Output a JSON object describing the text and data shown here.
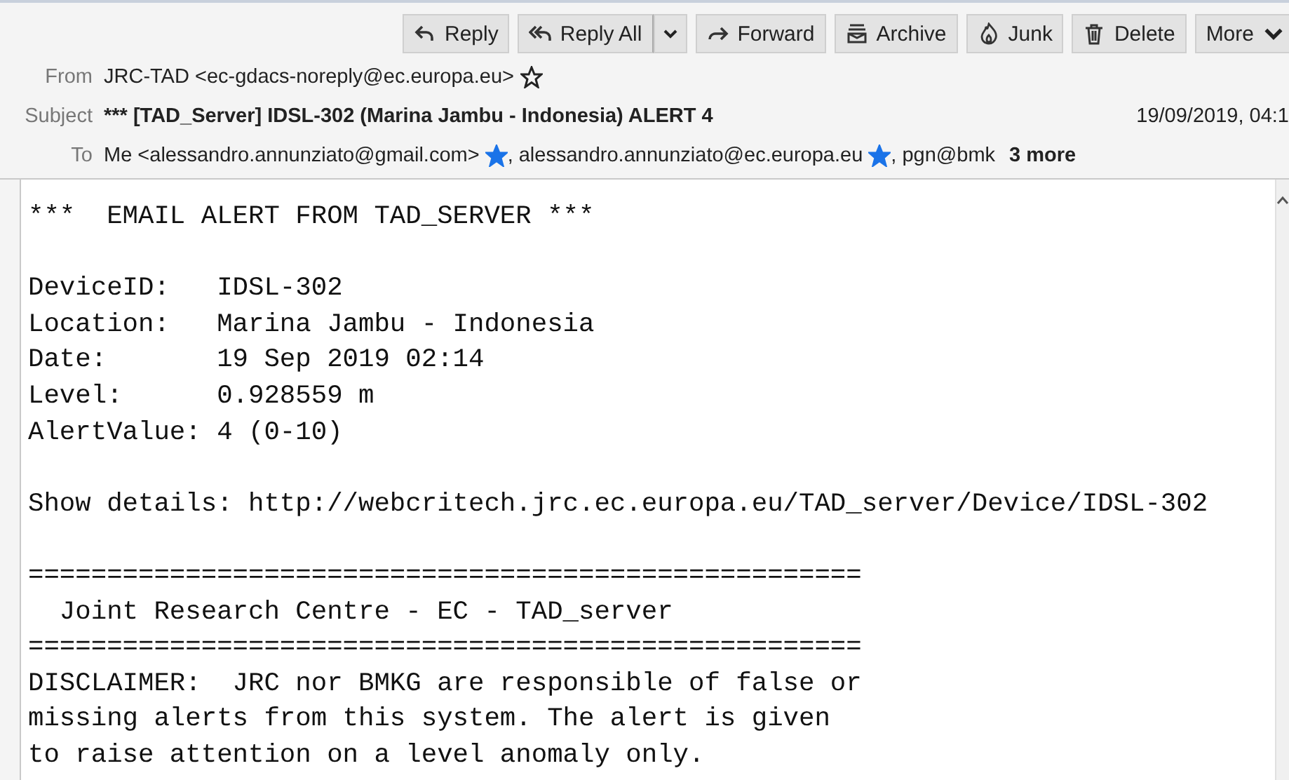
{
  "toolbar": [
    {
      "label": "Reply",
      "dropdown": false
    },
    {
      "label": "Reply All",
      "dropdown": true
    },
    {
      "label": "Forward",
      "dropdown": false
    },
    {
      "label": "Archive",
      "dropdown": false
    },
    {
      "label": "Junk",
      "dropdown": false
    },
    {
      "label": "Delete",
      "dropdown": false
    },
    {
      "label": "More",
      "dropdown": true
    }
  ],
  "from": {
    "label": "From",
    "value": "JRC-TAD <ec-gdacs-noreply@ec.europa.eu>",
    "starred": false
  },
  "subject": {
    "label": "Subject",
    "value": "*** [TAD_Server] IDSL-302 (Marina Jambu - Indonesia) ALERT 4",
    "date": "19/09/2019, 04:1"
  },
  "to": {
    "label": "To",
    "recipients": [
      {
        "text": "Me <alessandro.annunziato@gmail.com>",
        "starred": true
      },
      {
        "text": ", alessandro.annunziato@ec.europa.eu",
        "starred": true
      },
      {
        "text": ", pgn@bmk",
        "starred": false
      }
    ],
    "more": "3 more"
  },
  "body": [
    [
      "***  EMAIL ALERT FROM TAD_SERVER ***"
    ],
    [
      "DeviceID:   IDSL-302",
      "Location:   Marina Jambu - Indonesia",
      "Date:       19 Sep 2019 02:14",
      "Level:      0.928559 m",
      "AlertValue: 4 (0-10)"
    ],
    [
      "Show details: http://webcritech.jrc.ec.europa.eu/TAD_server/Device/IDSL-302"
    ],
    [
      "=====================================================",
      "  Joint Research Centre - EC - TAD_server",
      "=====================================================",
      "DISCLAIMER:  JRC nor BMKG are responsible of false or",
      "missing alerts from this system. The alert is given",
      "to raise attention on a level anomaly only."
    ]
  ]
}
